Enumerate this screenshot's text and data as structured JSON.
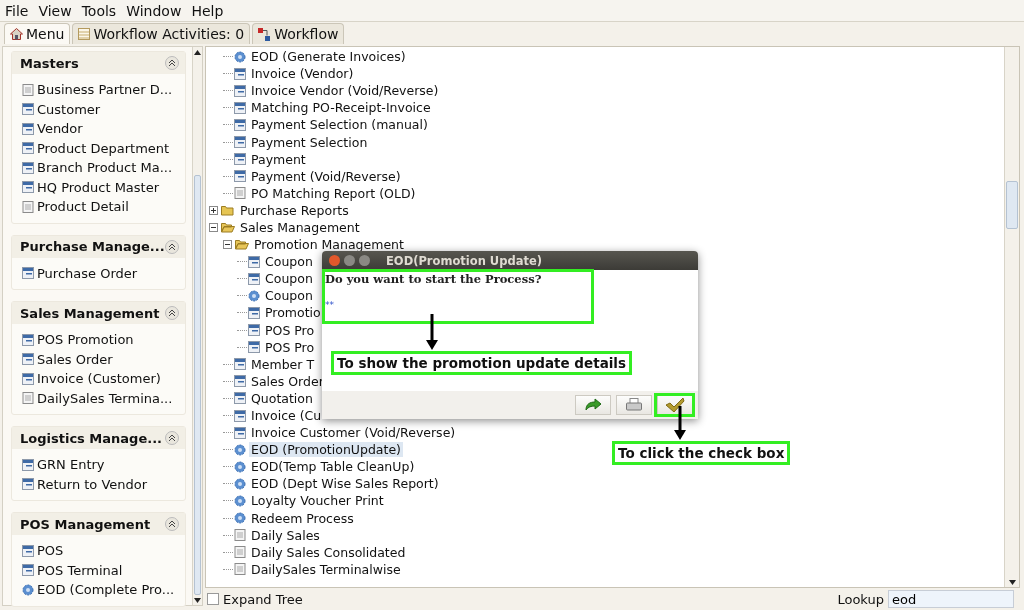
{
  "menu_bar": [
    "File",
    "View",
    "Tools",
    "Window",
    "Help"
  ],
  "tabs": [
    {
      "label": "Menu",
      "kind": "home",
      "selected": true
    },
    {
      "label": "Workflow Activities: 0",
      "kind": "list",
      "selected": false
    },
    {
      "label": "Workflow",
      "kind": "flow",
      "selected": false
    }
  ],
  "sidebar": [
    {
      "title": "Masters",
      "items": [
        {
          "label": "Business Partner D...",
          "kind": "report"
        },
        {
          "label": "Customer",
          "kind": "window"
        },
        {
          "label": "Vendor",
          "kind": "window"
        },
        {
          "label": "Product Department",
          "kind": "window"
        },
        {
          "label": "Branch Product Ma...",
          "kind": "window"
        },
        {
          "label": "HQ Product Master",
          "kind": "window"
        },
        {
          "label": "Product Detail",
          "kind": "report"
        }
      ]
    },
    {
      "title": "Purchase Manage...",
      "items": [
        {
          "label": "Purchase Order",
          "kind": "window"
        }
      ]
    },
    {
      "title": "Sales Management",
      "items": [
        {
          "label": "POS Promotion",
          "kind": "window"
        },
        {
          "label": "Sales Order",
          "kind": "window"
        },
        {
          "label": "Invoice (Customer)",
          "kind": "window"
        },
        {
          "label": "DailySales Termina...",
          "kind": "report"
        }
      ]
    },
    {
      "title": "Logistics Manage...",
      "items": [
        {
          "label": "GRN Entry",
          "kind": "window"
        },
        {
          "label": "Return to Vendor",
          "kind": "window"
        }
      ]
    },
    {
      "title": "POS Management",
      "items": [
        {
          "label": "POS",
          "kind": "window"
        },
        {
          "label": "POS Terminal",
          "kind": "window"
        },
        {
          "label": "EOD (Complete Pro...",
          "kind": "process"
        }
      ]
    }
  ],
  "tree": {
    "partial_group": [
      {
        "label": "EOD (Generate Invoices)",
        "kind": "process",
        "selected": false
      },
      {
        "label": "Invoice (Vendor)",
        "kind": "window",
        "selected": false
      },
      {
        "label": "Invoice Vendor (Void/Reverse)",
        "kind": "window",
        "selected": false
      },
      {
        "label": "Matching PO-Receipt-Invoice",
        "kind": "window",
        "selected": false
      },
      {
        "label": "Payment Selection (manual)",
        "kind": "window",
        "selected": false
      },
      {
        "label": "Payment Selection",
        "kind": "window",
        "selected": false
      },
      {
        "label": "Payment",
        "kind": "window",
        "selected": false
      },
      {
        "label": "Payment (Void/Reverse)",
        "kind": "window",
        "selected": false
      },
      {
        "label": "PO Matching Report (OLD)",
        "kind": "report",
        "selected": false
      }
    ],
    "nodes": [
      {
        "label": "Purchase Reports",
        "kind": "folder",
        "expanded": false,
        "selected": false
      },
      {
        "label": "Sales Management",
        "kind": "folder",
        "expanded": true,
        "selected": false,
        "children": [
          {
            "label": "Promotion Management",
            "kind": "folder",
            "expanded": true,
            "selected": false,
            "children": [
              {
                "label": "Coupon",
                "kind": "window",
                "selected": false
              },
              {
                "label": "Coupon",
                "kind": "window",
                "selected": false
              },
              {
                "label": "Coupon",
                "kind": "process",
                "selected": false
              },
              {
                "label": "Promotio",
                "kind": "window",
                "selected": false
              },
              {
                "label": "POS Pro",
                "kind": "window",
                "selected": false
              },
              {
                "label": "POS Pro",
                "kind": "window",
                "selected": false
              }
            ]
          },
          {
            "label": "Member T",
            "kind": "window",
            "selected": false
          },
          {
            "label": "Sales Order",
            "kind": "window",
            "selected": false
          },
          {
            "label": "Quotation",
            "kind": "window",
            "selected": false
          },
          {
            "label": "Invoice (Cu",
            "kind": "window",
            "selected": false
          },
          {
            "label": "Invoice Customer (Void/Reverse)",
            "kind": "window",
            "selected": false
          },
          {
            "label": "EOD (PromotionUpdate)",
            "kind": "process",
            "selected": true
          },
          {
            "label": "EOD(Temp Table CleanUp)",
            "kind": "process",
            "selected": false
          },
          {
            "label": "EOD (Dept Wise Sales Report)",
            "kind": "process",
            "selected": false
          },
          {
            "label": "Loyalty Voucher Print",
            "kind": "process",
            "selected": false
          },
          {
            "label": "Redeem Process",
            "kind": "process",
            "selected": false
          },
          {
            "label": "Daily Sales",
            "kind": "report",
            "selected": false
          },
          {
            "label": "Daily Sales Consolidated",
            "kind": "report",
            "selected": false
          },
          {
            "label": "DailySales Terminalwise",
            "kind": "report",
            "selected": false
          }
        ]
      }
    ]
  },
  "bottom_bar": {
    "expand_tree": {
      "label": "Expand Tree",
      "checked": false
    },
    "lookup": {
      "label": "Lookup",
      "value": "eod"
    }
  },
  "dialog": {
    "title": "EOD(Promotion Update)",
    "message": "Do you want to start the Process?",
    "note": "**",
    "buttons": [
      {
        "kind": "redo"
      },
      {
        "kind": "print"
      },
      {
        "kind": "ok"
      }
    ]
  },
  "callouts": [
    {
      "text": "To show the promotion update details"
    },
    {
      "text": "To click the check box"
    }
  ]
}
